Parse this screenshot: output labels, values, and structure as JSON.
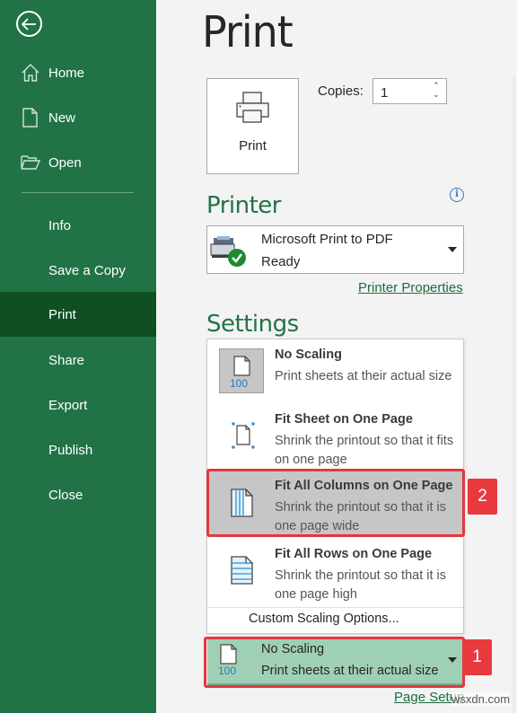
{
  "sidebar": {
    "back_label": "Back",
    "items": [
      {
        "label": "Home",
        "icon": "home-icon"
      },
      {
        "label": "New",
        "icon": "new-document-icon"
      },
      {
        "label": "Open",
        "icon": "open-folder-icon"
      },
      {
        "label": "Info"
      },
      {
        "label": "Save a Copy"
      },
      {
        "label": "Print",
        "active": true
      },
      {
        "label": "Share"
      },
      {
        "label": "Export"
      },
      {
        "label": "Publish"
      },
      {
        "label": "Close"
      }
    ]
  },
  "main": {
    "title": "Print",
    "print_button_label": "Print",
    "copies_label": "Copies:",
    "copies_value": "1",
    "printer": {
      "heading": "Printer",
      "name": "Microsoft Print to PDF",
      "status": "Ready",
      "properties_link": "Printer Properties"
    },
    "settings": {
      "heading": "Settings",
      "scaling_options": [
        {
          "title": "No Scaling",
          "description": "Print sheets at their actual size",
          "icon_label": "100"
        },
        {
          "title": "Fit Sheet on One Page",
          "description": "Shrink the printout so that it fits on one page"
        },
        {
          "title": "Fit All Columns on One Page",
          "description": "Shrink the printout so that it is one page wide"
        },
        {
          "title": "Fit All Rows on One Page",
          "description": "Shrink the printout so that it is one page high"
        }
      ],
      "custom_option": "Custom Scaling Options...",
      "current": {
        "title": "No Scaling",
        "description": "Print sheets at their actual size",
        "icon_label": "100"
      },
      "page_setup_link": "Page Setup"
    },
    "annotations": {
      "badge_1": "1",
      "badge_2": "2"
    },
    "watermark": "wsxdn.com"
  },
  "colors": {
    "sidebar_bg": "#217346",
    "sidebar_active": "#0f4f22",
    "accent_green": "#217346",
    "highlight_red": "#e8393f",
    "current_selection_bg": "#9fd0b6"
  }
}
